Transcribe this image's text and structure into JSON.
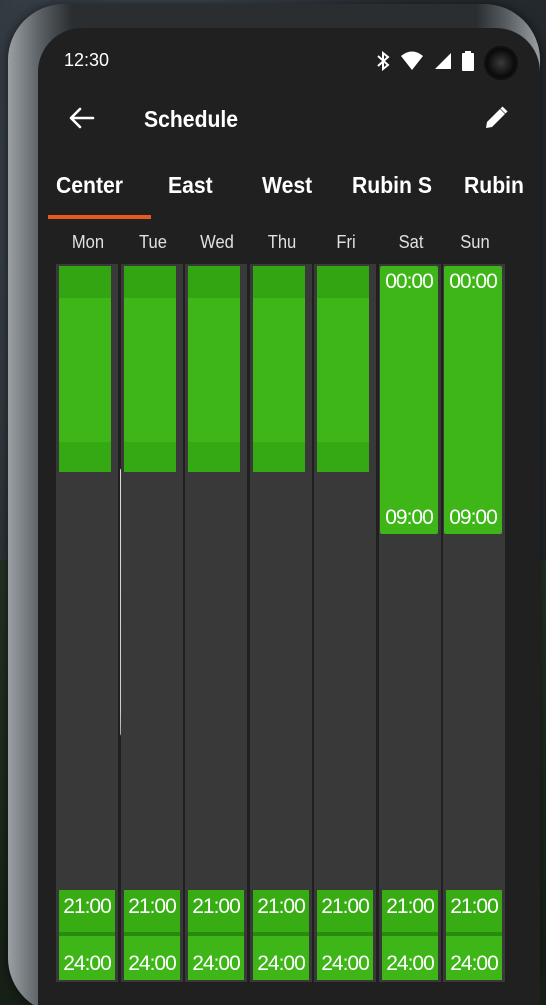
{
  "status_bar": {
    "time": "12:30",
    "icons": [
      "bluetooth-icon",
      "wifi-icon",
      "cell-signal-icon",
      "battery-icon"
    ]
  },
  "app_bar": {
    "title": "Schedule",
    "back_icon": "arrow-back-icon",
    "edit_icon": "pencil-icon"
  },
  "tabs": [
    {
      "label": "Center",
      "selected": true
    },
    {
      "label": "East",
      "selected": false
    },
    {
      "label": "West",
      "selected": false
    },
    {
      "label": "Rubin S",
      "selected": false
    },
    {
      "label": "Rubin",
      "selected": false
    }
  ],
  "days": [
    "Mon",
    "Tue",
    "Wed",
    "Thu",
    "Fri",
    "Sat",
    "Sun"
  ],
  "schedule": {
    "Sat": {
      "morning_start": "00:00",
      "morning_end": "09:00",
      "night_start": "21:00",
      "night_end": "24:00"
    },
    "Sun": {
      "morning_start": "00:00",
      "morning_end": "09:00",
      "night_start": "21:00",
      "night_end": "24:00"
    },
    "Mon": {
      "night_start": "21:00",
      "night_end": "24:00"
    },
    "Tue": {
      "night_start": "21:00",
      "night_end": "24:00"
    },
    "Wed": {
      "night_start": "21:00",
      "night_end": "24:00"
    },
    "Thu": {
      "night_start": "21:00",
      "night_end": "24:00"
    },
    "Fri": {
      "night_start": "21:00",
      "night_end": "24:00"
    }
  },
  "colors": {
    "accent": "#e65a1e",
    "block_green": "#3fb617",
    "column_bg": "#3a393a",
    "screen_bg": "#202020"
  }
}
